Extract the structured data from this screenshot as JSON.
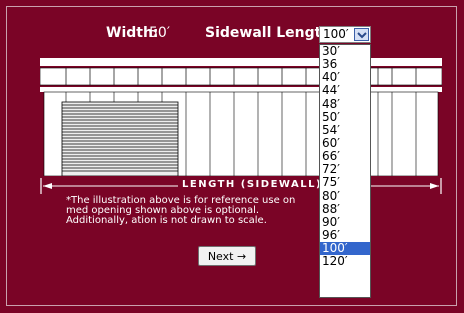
{
  "header": {
    "width_label": "Width:",
    "width_value": "50′",
    "sidewall_label": "Sidewall Length:"
  },
  "sidewall_select": {
    "selected": "100′",
    "options": [
      "30′",
      "36",
      "40′",
      "44′",
      "48′",
      "50′",
      "54′",
      "60′",
      "66′",
      "72′",
      "75′",
      "80′",
      "88′",
      "90′",
      "96′",
      "100′",
      "120′"
    ]
  },
  "illustration": {
    "length_caption": "LENGTH (SIDEWALL)"
  },
  "note": {
    "text": "*The illustration above is for reference use on       med opening shown above is optional. Additionally,        ation is not drawn to scale."
  },
  "buttons": {
    "next_label": "Next →"
  },
  "colors": {
    "background": "#7a0426",
    "selected_option": "#3366cc"
  }
}
